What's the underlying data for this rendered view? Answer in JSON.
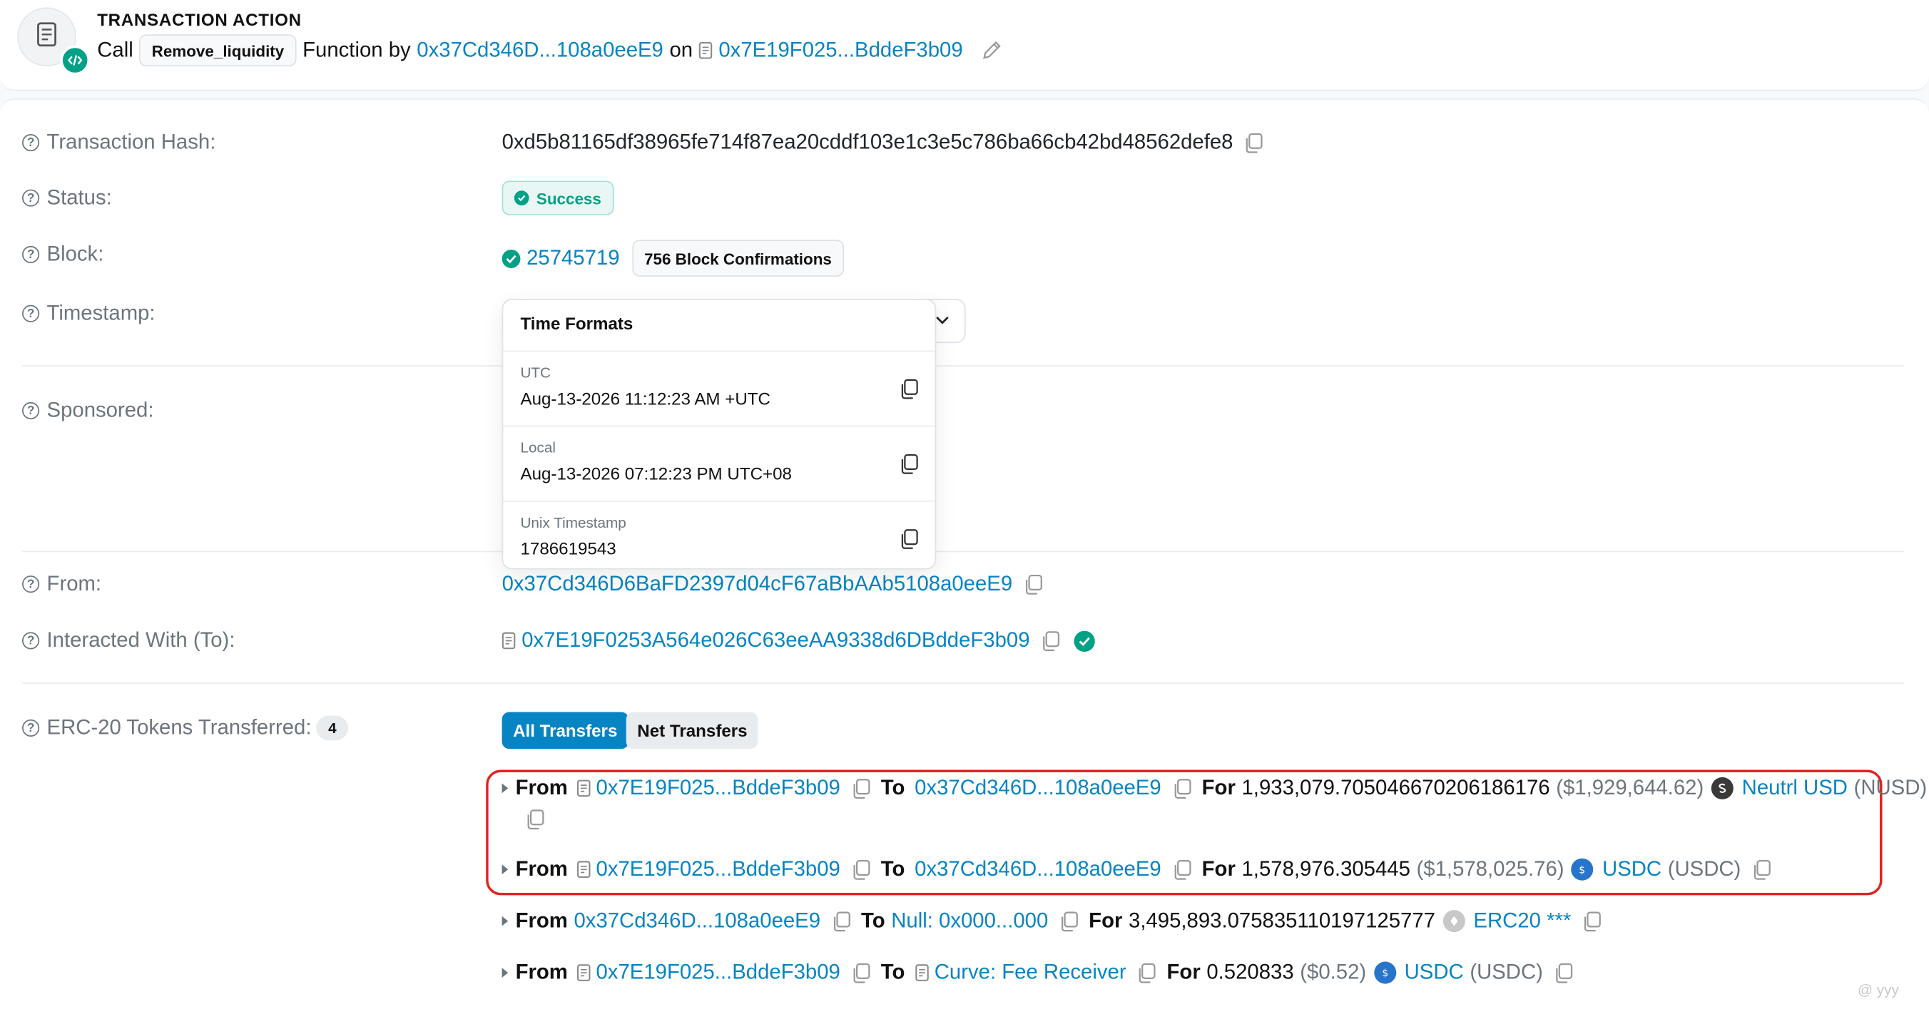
{
  "header": {
    "title": "TRANSACTION ACTION",
    "call": "Call",
    "method": "Remove_liquidity",
    "function_by": "Function by",
    "from_short": "0x37Cd346D...108a0eeE9",
    "on": "on",
    "contract_short": "0x7E19F025...BddeF3b09"
  },
  "labels": {
    "tx_hash": "Transaction Hash:",
    "status": "Status:",
    "block": "Block:",
    "timestamp": "Timestamp:",
    "sponsored": "Sponsored:",
    "from": "From:",
    "interacted": "Interacted With (To):",
    "erc20": "ERC-20 Tokens Transferred:"
  },
  "tx_hash": "0xd5b81165df38965fe714f87ea20cddf103e1c3e5c786ba66cb42bd48562defe8",
  "status": "Success",
  "block": {
    "number": "25745719",
    "confirmations": "756 Block Confirmations"
  },
  "time_formats": {
    "title": "Time Formats",
    "items": [
      {
        "label": "UTC",
        "value": "Aug-13-2026 11:12:23 AM +UTC"
      },
      {
        "label": "Local",
        "value": "Aug-13-2026 07:12:23 PM UTC+08"
      },
      {
        "label": "Unix Timestamp",
        "value": "1786619543"
      }
    ]
  },
  "from_address": "0x37Cd346D6BaFD2397d04cF67aBbAAb5108a0eeE9",
  "to_address": "0x7E19F0253A564e026C63eeAA9338d6DBddeF3b09",
  "erc20_count": "4",
  "tabs": {
    "all": "All Transfers",
    "net": "Net Transfers"
  },
  "transfers": [
    {
      "from_kw": "From",
      "from": "0x7E19F025...BddeF3b09",
      "to_kw": "To",
      "to": "0x37Cd346D...108a0eeE9",
      "for_kw": "For",
      "amount": "1,933,079.705046670206186176",
      "usd": "($1,929,644.62)",
      "token": "Neutrl USD",
      "symbol": "(NUSD)"
    },
    {
      "from_kw": "From",
      "from": "0x7E19F025...BddeF3b09",
      "to_kw": "To",
      "to": "0x37Cd346D...108a0eeE9",
      "for_kw": "For",
      "amount": "1,578,976.305445",
      "usd": "($1,578,025.76)",
      "token": "USDC",
      "symbol": "(USDC)"
    },
    {
      "from_kw": "From",
      "from": "0x37Cd346D...108a0eeE9",
      "to_kw": "To",
      "to": "Null: 0x000...000",
      "for_kw": "For",
      "amount": "3,495,893.075835110197125777",
      "usd": "",
      "token": "ERC20 ***",
      "symbol": ""
    },
    {
      "from_kw": "From",
      "from": "0x7E19F025...BddeF3b09",
      "to_kw": "To",
      "to": "Curve: Fee Receiver",
      "for_kw": "For",
      "amount": "0.520833",
      "usd": "($0.52)",
      "token": "USDC",
      "symbol": "(USDC)"
    }
  ],
  "watermark": "@ yyy",
  "colors": {
    "link": "#0784c3",
    "success": "#00a186",
    "highlight": "#e32121"
  }
}
